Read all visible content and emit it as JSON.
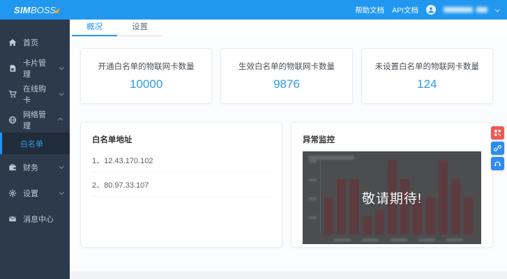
{
  "brand": {
    "sim": "SIM",
    "boss": "BOSS"
  },
  "topbar": {
    "help_link": "帮助文档",
    "api_link": "API文档",
    "user_masked": true
  },
  "sidebar": {
    "items": [
      {
        "label": "首页",
        "icon": "home-icon"
      },
      {
        "label": "卡片管理",
        "icon": "sim-card-icon",
        "chevron": "down"
      },
      {
        "label": "在线购卡",
        "icon": "cart-icon",
        "chevron": "down"
      },
      {
        "label": "网络管理",
        "icon": "network-icon",
        "chevron": "up",
        "expanded": true
      },
      {
        "label": "财务",
        "icon": "finance-icon",
        "chevron": "down"
      },
      {
        "label": "设置",
        "icon": "gear-icon",
        "chevron": "down"
      },
      {
        "label": "消息中心",
        "icon": "message-icon"
      }
    ],
    "submenu": {
      "label": "白名单",
      "active": true
    }
  },
  "tabs": {
    "overview": "概况",
    "settings": "设置"
  },
  "stats": [
    {
      "label": "开通白名单的物联网卡数量",
      "value": "10000"
    },
    {
      "label": "生效白名单的物联网卡数量",
      "value": "9876"
    },
    {
      "label": "未设置白名单的物联网卡数量",
      "value": "124"
    }
  ],
  "whitelist": {
    "title": "白名单地址",
    "items": [
      "1、12.43.170.102",
      "2、80.97.33.107"
    ]
  },
  "monitor": {
    "title": "异常监控",
    "overlay": "敬请期待!"
  },
  "chart_data": {
    "type": "bar",
    "title": "异常监控",
    "values": [
      0.5,
      0.75,
      0.75,
      0.25,
      0.33,
      1.0,
      0.75,
      0.5,
      0.5,
      1.0,
      0.75,
      0.5
    ],
    "ylim": [
      0,
      1
    ],
    "overlay_text": "敬请期待!",
    "note": "chart is dimmed behind a coming-soon overlay; axis tick labels are illegible in the screenshot"
  },
  "floating_buttons": [
    {
      "icon": "qrcode-icon",
      "color": "#ee5a52"
    },
    {
      "icon": "link-icon",
      "color": "#2d8cf0"
    },
    {
      "icon": "headset-icon",
      "color": "#2d8cf0"
    }
  ],
  "colors": {
    "topbar": "#2197f0",
    "sidebar": "#2d3a4b",
    "accent": "#2196f3",
    "stat_value": "#2f9be3",
    "chart_bg": "#4b4d4f",
    "chart_bar": "#5d3c40"
  }
}
